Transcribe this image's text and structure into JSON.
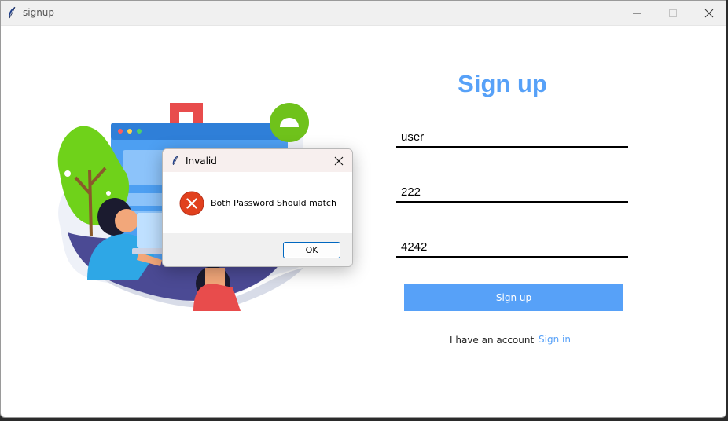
{
  "window": {
    "title": "signup",
    "icon": "feather-icon"
  },
  "titlebar_buttons": [
    "minimize-icon",
    "maximize-icon",
    "close-icon"
  ],
  "form": {
    "heading": "Sign up",
    "username_value": "user",
    "password_value": "222",
    "confirm_password_value": "4242",
    "submit_label": "Sign up",
    "have_account_text": "I have an account",
    "signin_link": "Sign in"
  },
  "dialog": {
    "title": "Invalid",
    "icon": "error-icon",
    "message": "Both Password Should match",
    "ok_label": "OK"
  },
  "colors": {
    "accent": "#57a1f8",
    "error": "#e1401d",
    "dialog_titlebar": "#f7efee"
  }
}
